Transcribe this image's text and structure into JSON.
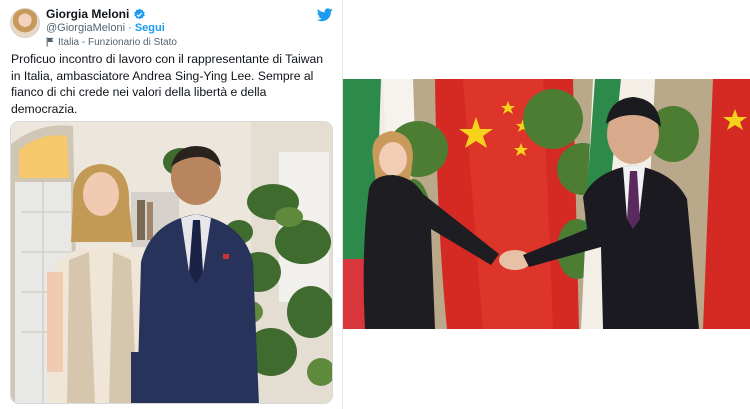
{
  "tweet": {
    "display_name": "Giorgia Meloni",
    "handle": "@GiorgiaMeloni",
    "separator": "·",
    "follow_label": "Segui",
    "account_label": "Italia - Funzionario di Stato",
    "text": "Proficuo incontro di lavoro con il rappresentante di Taiwan in Italia, ambasciatore Andrea Sing-Ying Lee. Sempre al fianco di chi crede nei valori della libertà e della democrazia.",
    "icons": {
      "verified": "verified-badge-icon",
      "account_label": "flag-icon",
      "brand": "twitter-bird-icon"
    }
  },
  "colors": {
    "twitter_blue": "#1d9bf0",
    "text_primary": "#0f1419",
    "text_secondary": "#536471"
  }
}
